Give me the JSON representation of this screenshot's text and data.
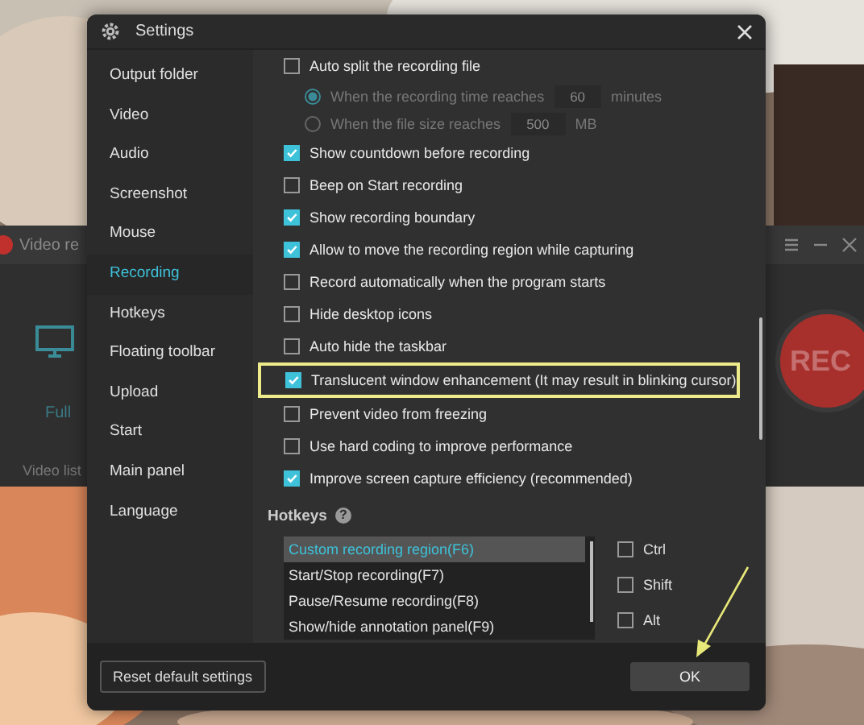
{
  "background_app": {
    "title": "Video re",
    "mode_label": "Full",
    "video_list": "Video list",
    "rec_button": "REC"
  },
  "window": {
    "title": "Settings"
  },
  "sidebar": {
    "items": [
      {
        "label": "Output folder",
        "selected": false
      },
      {
        "label": "Video",
        "selected": false
      },
      {
        "label": "Audio",
        "selected": false
      },
      {
        "label": "Screenshot",
        "selected": false
      },
      {
        "label": "Mouse",
        "selected": false
      },
      {
        "label": "Recording",
        "selected": true
      },
      {
        "label": "Hotkeys",
        "selected": false
      },
      {
        "label": "Floating toolbar",
        "selected": false
      },
      {
        "label": "Upload",
        "selected": false
      },
      {
        "label": "Start",
        "selected": false
      },
      {
        "label": "Main panel",
        "selected": false
      },
      {
        "label": "Language",
        "selected": false
      }
    ]
  },
  "options": [
    {
      "kind": "checkbox",
      "label": "Auto split the recording file",
      "checked": false,
      "highlighted": false
    },
    {
      "kind": "radio",
      "label": "When the recording time reaches",
      "value": "60",
      "unit": "minutes",
      "selected": true,
      "disabled": true
    },
    {
      "kind": "radio",
      "label": "When the file size reaches",
      "value": "500",
      "unit": "MB",
      "selected": false,
      "disabled": true
    },
    {
      "kind": "checkbox",
      "label": "Show countdown before recording",
      "checked": true,
      "highlighted": false
    },
    {
      "kind": "checkbox",
      "label": "Beep on Start recording",
      "checked": false,
      "highlighted": false
    },
    {
      "kind": "checkbox",
      "label": "Show recording boundary",
      "checked": true,
      "highlighted": false
    },
    {
      "kind": "checkbox",
      "label": "Allow to move the recording region while capturing",
      "checked": true,
      "highlighted": false
    },
    {
      "kind": "checkbox",
      "label": "Record automatically when the program starts",
      "checked": false,
      "highlighted": false
    },
    {
      "kind": "checkbox",
      "label": "Hide desktop icons",
      "checked": false,
      "highlighted": false
    },
    {
      "kind": "checkbox",
      "label": "Auto hide the taskbar",
      "checked": false,
      "highlighted": false
    },
    {
      "kind": "checkbox",
      "label": "Translucent window enhancement (It may result in blinking cursor)",
      "checked": true,
      "highlighted": true
    },
    {
      "kind": "checkbox",
      "label": "Prevent video from freezing",
      "checked": false,
      "highlighted": false
    },
    {
      "kind": "checkbox",
      "label": "Use hard coding to improve performance",
      "checked": false,
      "highlighted": false
    },
    {
      "kind": "checkbox",
      "label": "Improve screen capture efficiency (recommended)",
      "checked": true,
      "highlighted": false
    }
  ],
  "hotkeys": {
    "title": "Hotkeys",
    "help_icon": "?",
    "actions": [
      {
        "label": "Custom recording region(F6)",
        "selected": true
      },
      {
        "label": "Start/Stop recording(F7)",
        "selected": false
      },
      {
        "label": "Pause/Resume recording(F8)",
        "selected": false
      },
      {
        "label": "Show/hide annotation panel(F9)",
        "selected": false
      }
    ],
    "modifiers": [
      {
        "label": "Ctrl",
        "checked": false
      },
      {
        "label": "Shift",
        "checked": false
      },
      {
        "label": "Alt",
        "checked": false
      }
    ]
  },
  "footer": {
    "reset_button": "Reset default settings",
    "ok_button": "OK"
  }
}
